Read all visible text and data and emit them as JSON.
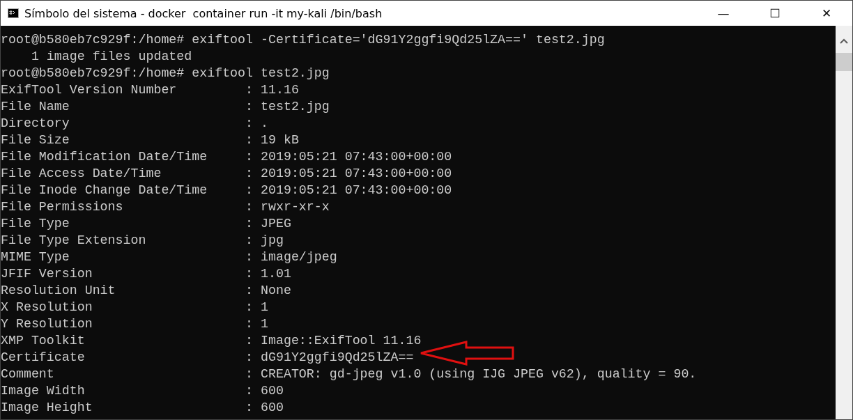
{
  "window": {
    "title": "Símbolo del sistema - docker  container run -it my-kali /bin/bash",
    "controls": [
      "—",
      "☐",
      "✕"
    ]
  },
  "terminal": {
    "lines": [
      "root@b580eb7c929f:/home# exiftool -Certificate='dG91Y2ggfi9Qd25lZA==' test2.jpg",
      "    1 image files updated",
      "root@b580eb7c929f:/home# exiftool test2.jpg",
      "ExifTool Version Number         : 11.16",
      "File Name                       : test2.jpg",
      "Directory                       : .",
      "File Size                       : 19 kB",
      "File Modification Date/Time     : 2019:05:21 07:43:00+00:00",
      "File Access Date/Time           : 2019:05:21 07:43:00+00:00",
      "File Inode Change Date/Time     : 2019:05:21 07:43:00+00:00",
      "File Permissions                : rwxr-xr-x",
      "File Type                       : JPEG",
      "File Type Extension             : jpg",
      "MIME Type                       : image/jpeg",
      "JFIF Version                    : 1.01",
      "Resolution Unit                 : None",
      "X Resolution                    : 1",
      "Y Resolution                    : 1",
      "XMP Toolkit                     : Image::ExifTool 11.16",
      "Certificate                     : dG91Y2ggfi9Qd25lZA==",
      "Comment                         : CREATOR: gd-jpeg v1.0 (using IJG JPEG v62), quality = 90.",
      "Image Width                     : 600",
      "Image Height                    : 600"
    ]
  }
}
